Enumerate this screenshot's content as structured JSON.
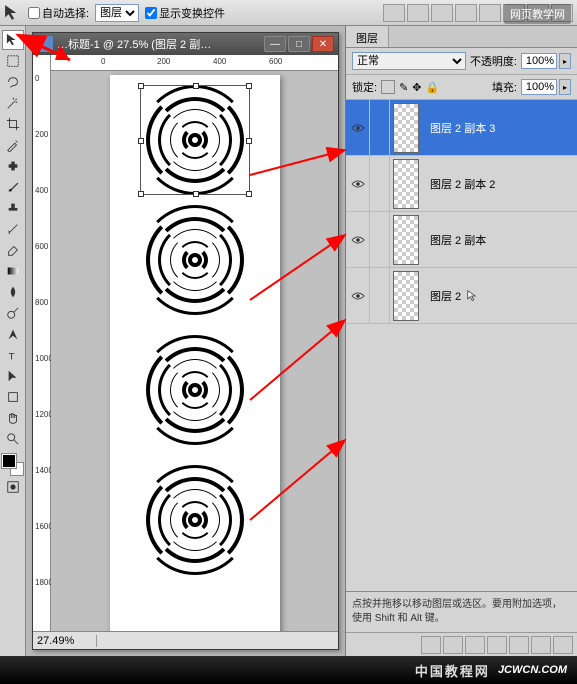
{
  "topbar": {
    "auto_select_label": "自动选择:",
    "auto_select_value": "图层",
    "show_transform_label": "显示变换控件"
  },
  "brand": "网页教学网",
  "doc": {
    "title": "…标题-1 @ 27.5% (图层 2 副…",
    "zoom": "27.49%",
    "hruler": [
      "0",
      "200",
      "400",
      "600"
    ],
    "vruler": [
      "0",
      "200",
      "400",
      "600",
      "800",
      "1000",
      "1200",
      "1400",
      "1600",
      "1800"
    ]
  },
  "panel": {
    "tab": "图层",
    "blend_mode": "正常",
    "opacity_label": "不透明度:",
    "opacity_value": "100%",
    "lock_label": "锁定:",
    "fill_label": "填充:",
    "fill_value": "100%",
    "layers": [
      {
        "name": "图层 2 副本 3",
        "selected": true
      },
      {
        "name": "图层 2 副本 2",
        "selected": false
      },
      {
        "name": "图层 2 副本",
        "selected": false
      },
      {
        "name": "图层 2",
        "selected": false
      }
    ],
    "hint": "点按并拖移以移动图层或选区。要用附加选项，使用 Shift 和 Alt 键。"
  },
  "footer": {
    "cn": "中国教程网",
    "en": "JCWCN.COM"
  }
}
